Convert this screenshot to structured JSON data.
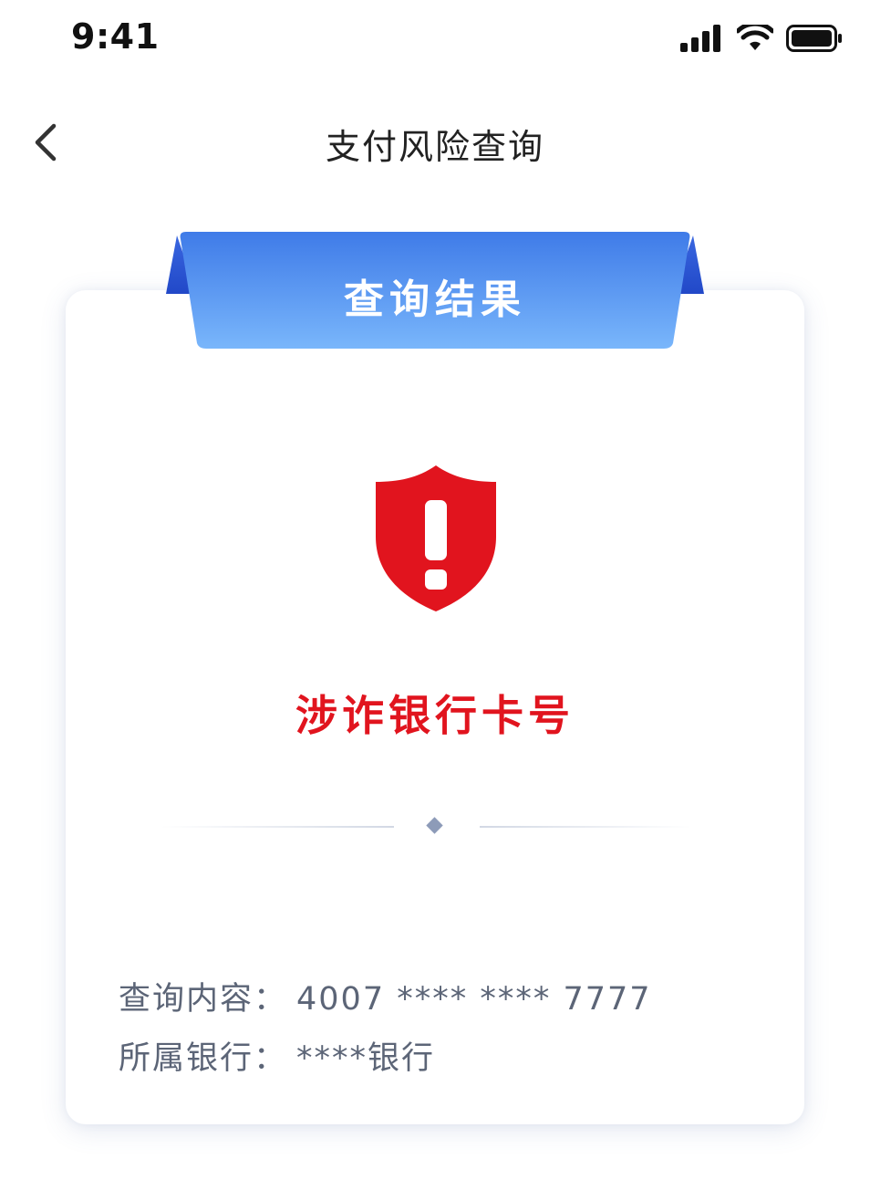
{
  "status_bar": {
    "time": "9:41",
    "icons": [
      "signal-icon",
      "wifi-icon",
      "battery-icon"
    ]
  },
  "nav": {
    "back_icon": "chevron-left-icon",
    "title": "支付风险查询"
  },
  "card": {
    "ribbon_title": "查询结果",
    "status_icon": "alert-shield-icon",
    "result_title": "涉诈银行卡号",
    "rows": [
      {
        "label": "查询内容：",
        "value": "4007 **** **** 7777"
      },
      {
        "label": "所属银行：",
        "value": "****银行"
      }
    ]
  },
  "colors": {
    "ribbon_gradient_top": "#3f7be8",
    "ribbon_gradient_bottom": "#79b6fb",
    "ribbon_fold": "#2b55d2",
    "danger": "#e1141e",
    "text_secondary": "#5c6577"
  }
}
